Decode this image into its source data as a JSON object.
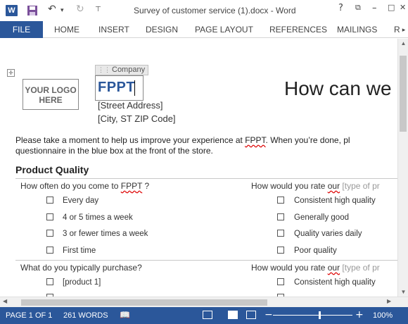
{
  "titlebar": {
    "app_icon": "W",
    "title": "Survey of customer service (1).docx - Word",
    "undo_icon": "↶",
    "redo_icon": "↻",
    "help_icon": "?",
    "minimize_icon": "–",
    "restore_icon": "□",
    "close_icon": "✕"
  },
  "ribbon": {
    "tabs": [
      "FILE",
      "HOME",
      "INSERT",
      "DESIGN",
      "PAGE LAYOUT",
      "REFERENCES",
      "MAILINGS",
      "R"
    ]
  },
  "document": {
    "logo_text": "YOUR LOGO HERE",
    "company_tag": "Company",
    "company_value": "FPPT",
    "street": "[Street Address]",
    "city": "[City, ST  ZIP Code]",
    "heading": "How can we",
    "intro_line1_pre": "Please take a moment to help us improve your experience at ",
    "intro_line1_brand": "FPPT",
    "intro_line1_post": ". When you’re done, pl",
    "intro_line2": "questionnaire in the blue box at the front of the store.",
    "section_title": "Product Quality",
    "q1_pre": "How often do you come to ",
    "q1_brand": "FPPT",
    "q1_post": " ?",
    "q1_options": [
      "Every day",
      "4 or 5 times a week",
      "3 or fewer times a week",
      "First time"
    ],
    "q2_pre": "How would you rate ",
    "q2_our": "our",
    "q2_placeholder": " [type of pr",
    "q2_options": [
      "Consistent high quality",
      "Generally good",
      "Quality varies daily",
      "Poor quality"
    ],
    "q3": "What do you typically purchase?",
    "q3_options": [
      "[product 1]"
    ],
    "q4_pre": "How would you rate ",
    "q4_our": "our",
    "q4_placeholder": " [type of pr",
    "q4_options": [
      "Consistent high quality"
    ]
  },
  "status": {
    "page": "PAGE 1 OF 1",
    "words": "261 WORDS",
    "zoom": "100%",
    "zoom_minus": "−",
    "zoom_plus": "+"
  },
  "colors": {
    "accent": "#2b579a"
  }
}
